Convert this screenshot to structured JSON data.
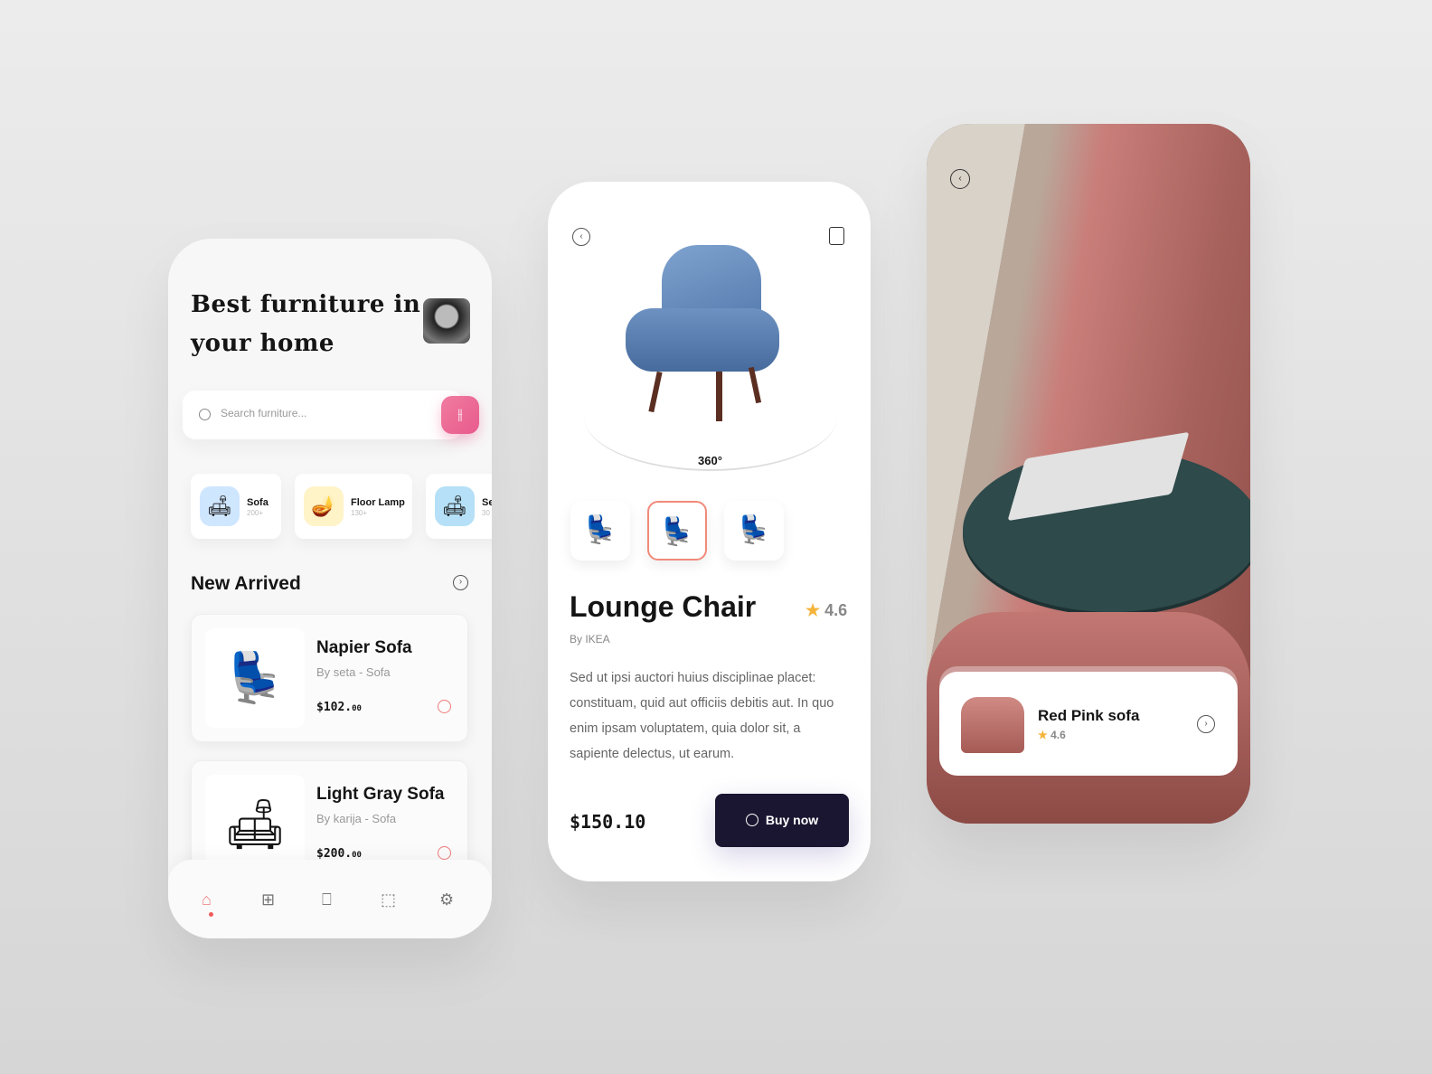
{
  "home": {
    "title_line1": "Best furniture in",
    "title_line2": "your home",
    "search_placeholder": "Search furniture...",
    "categories": [
      {
        "name": "Sofa",
        "count": "200+"
      },
      {
        "name": "Floor Lamp",
        "count": "130+"
      },
      {
        "name": "Se",
        "count": "30"
      }
    ],
    "section_title": "New Arrived",
    "products": [
      {
        "name": "Napier Sofa",
        "by": "By seta - Sofa",
        "price": "$102.",
        "cents": "00"
      },
      {
        "name": "Light Gray Sofa",
        "by": "By karija - Sofa",
        "price": "$200.",
        "cents": "00"
      }
    ],
    "nav": [
      "home-icon",
      "grid-icon",
      "bookmark-icon",
      "chart-icon",
      "settings-icon"
    ],
    "accent": "#f05a5a"
  },
  "detail": {
    "badge_360": "360°",
    "title": "Lounge Chair",
    "rating": "4.6",
    "brand": "By IKEA",
    "description": "Sed ut ipsi auctori huius disciplinae placet: constituam, quid aut officiis debitis aut. In quo enim ipsam voluptatem, quia dolor sit, a sapiente delectus, ut earum.",
    "price": "$150.10",
    "buy_label": "Buy now",
    "buy_color": "#1a1530"
  },
  "ar": {
    "product_name": "Red Pink sofa",
    "rating": "4.6"
  }
}
